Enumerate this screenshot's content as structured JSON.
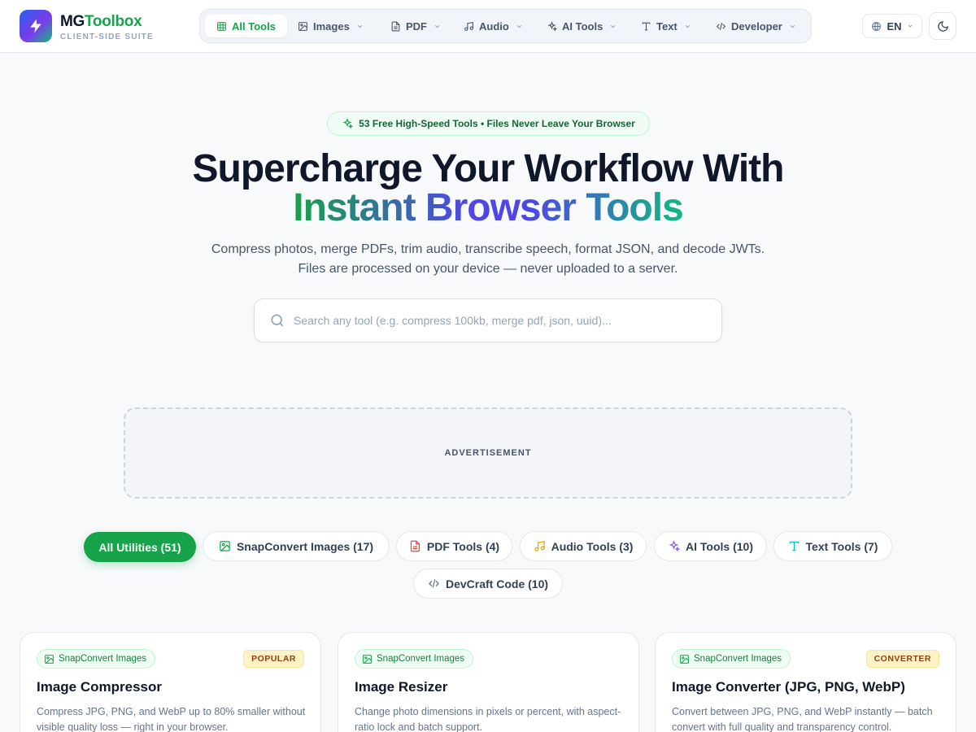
{
  "brand": {
    "name_main": "MG",
    "name_accent": "Toolbox",
    "subtitle": "CLIENT-SIDE SUITE"
  },
  "nav": {
    "items": [
      {
        "label": "All Tools",
        "icon": "grid-icon"
      },
      {
        "label": "Images",
        "icon": "image-icon"
      },
      {
        "label": "PDF",
        "icon": "file-icon"
      },
      {
        "label": "Audio",
        "icon": "music-icon"
      },
      {
        "label": "AI Tools",
        "icon": "sparkles-icon"
      },
      {
        "label": "Text",
        "icon": "type-icon"
      },
      {
        "label": "Developer",
        "icon": "code-icon"
      }
    ]
  },
  "language": {
    "label": "EN"
  },
  "hero": {
    "badge": "53 Free High-Speed Tools • Files Never Leave Your Browser",
    "title_line1": "Supercharge Your Workflow With",
    "title_line2": "Instant Browser Tools",
    "lead": "Compress photos, merge PDFs, trim audio, transcribe speech, format JSON, and decode JWTs. Files are processed on your device — never uploaded to a server."
  },
  "search": {
    "placeholder": "Search any tool (e.g. compress 100kb, merge pdf, json, uuid)..."
  },
  "ad": {
    "label": "ADVERTISEMENT"
  },
  "filters": [
    {
      "label": "All Utilities (51)",
      "active": true
    },
    {
      "label": "SnapConvert Images (17)",
      "icon": "image-icon"
    },
    {
      "label": "PDF Tools (4)",
      "icon": "file-icon"
    },
    {
      "label": "Audio Tools (3)",
      "icon": "music-icon"
    },
    {
      "label": "AI Tools (10)",
      "icon": "sparkles-icon"
    },
    {
      "label": "Text Tools (7)",
      "icon": "type-icon"
    },
    {
      "label": "DevCraft Code (10)",
      "icon": "code-icon"
    }
  ],
  "cards": [
    {
      "tag": "SnapConvert Images",
      "flag": "POPULAR",
      "title": "Image Compressor",
      "desc": "Compress JPG, PNG, and WebP up to 80% smaller without visible quality loss — right in your browser."
    },
    {
      "tag": "SnapConvert Images",
      "flag": "",
      "title": "Image Resizer",
      "desc": "Change photo dimensions in pixels or percent, with aspect-ratio lock and batch support."
    },
    {
      "tag": "SnapConvert Images",
      "flag": "CONVERTER",
      "title": "Image Converter (JPG, PNG, WebP)",
      "desc": "Convert between JPG, PNG, and WebP instantly — batch convert with full quality and transparency control."
    }
  ],
  "colors": {
    "accent": "#16a34a",
    "indigo": "#4f46e5",
    "pdf": "#ef4444",
    "audio": "#f59e0b",
    "ai": "#8b5cf6",
    "text": "#06b6d4"
  }
}
